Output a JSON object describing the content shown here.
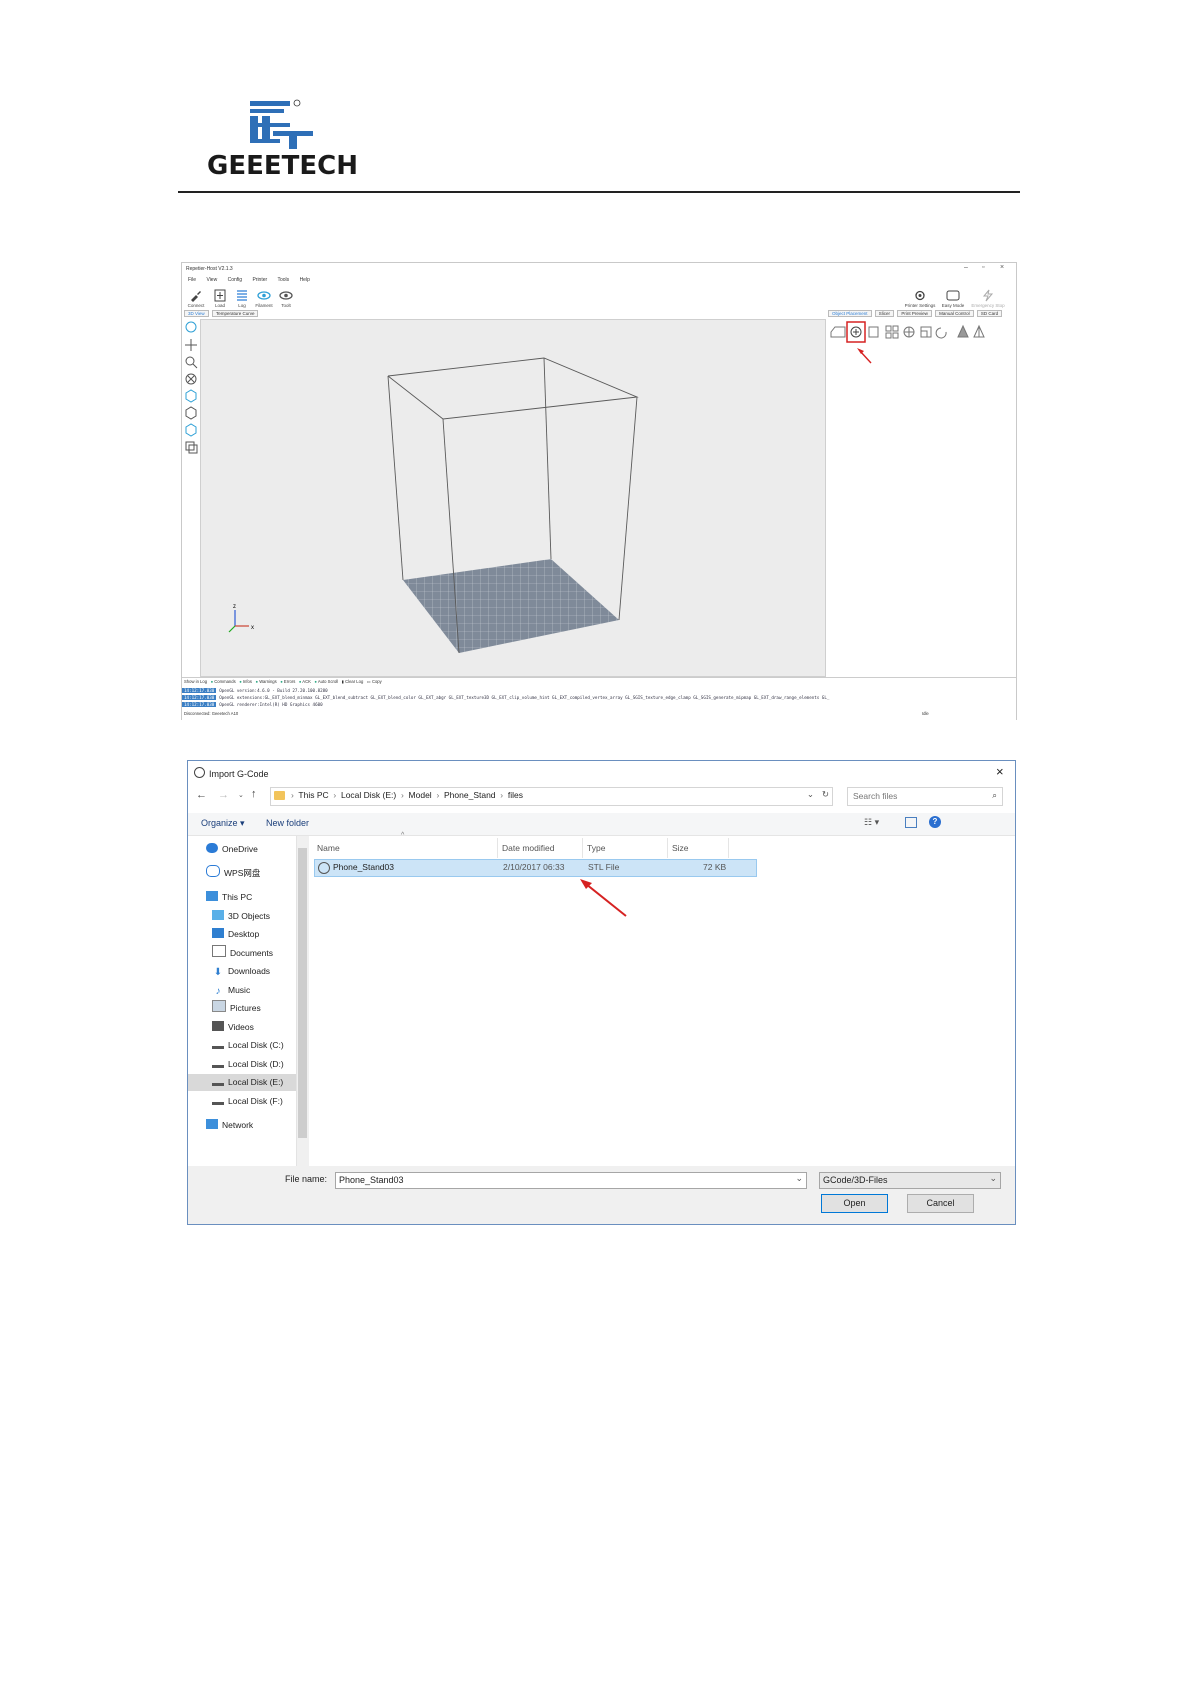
{
  "header": {
    "logo_text": "GEEETECH"
  },
  "repetier": {
    "title": "Repetier-Host V2.1.3",
    "menu": [
      "File",
      "View",
      "Config",
      "Printer",
      "Tools",
      "Help"
    ],
    "toolbar": [
      "Connect",
      "Load",
      "Log",
      "Filament",
      "Toolt"
    ],
    "right_toolbar": [
      "Printer Settings",
      "Easy Mode",
      "Emergency Stop"
    ],
    "left_tabs": [
      "3D View",
      "Temperature Curve"
    ],
    "right_tabs": [
      "Object Placement",
      "Slicer",
      "Print Preview",
      "Manual Control",
      "SD Card"
    ],
    "log_toolbar": [
      "Show in Log",
      "Commands",
      "Infos",
      "Warnings",
      "Errors",
      "ACK",
      "Auto Scroll",
      "Clear Log",
      "Copy"
    ],
    "log_lines": [
      {
        "time": "14:12:17.030",
        "msg": "OpenGL version:4.6.0 - Build 27.20.100.8280"
      },
      {
        "time": "14:12:17.030",
        "msg": "OpenGL extensions:GL_EXT_blend_minmax GL_EXT_blend_subtract GL_EXT_blend_color GL_EXT_abgr GL_EXT_texture3D GL_EXT_clip_volume_hint GL_EXT_compiled_vertex_array GL_SGIS_texture_edge_clamp GL_SGIS_generate_mipmap GL_EXT_draw_range_elements GL_"
      },
      {
        "time": "14:12:17.030",
        "msg": "OpenGL renderer:Intel(R) HD Graphics 4600"
      }
    ],
    "status_left": "Disconnected: Geeetech A10",
    "status_right": "Idle"
  },
  "dialog": {
    "title": "Import G-Code",
    "breadcrumb": [
      "This PC",
      "Local Disk (E:)",
      "Model",
      "Phone_Stand",
      "files"
    ],
    "search_placeholder": "Search files",
    "organize": "Organize ▾",
    "new_folder": "New folder",
    "nav": [
      {
        "label": "OneDrive",
        "icon": "cloud-icon",
        "indent": 1
      },
      {
        "label": "WPS网盘",
        "icon": "cloud-drive-icon",
        "indent": 1
      },
      {
        "label": "This PC",
        "icon": "computer-icon",
        "indent": 1
      },
      {
        "label": "3D Objects",
        "icon": "cube-icon",
        "indent": 2
      },
      {
        "label": "Desktop",
        "icon": "desktop-icon",
        "indent": 2
      },
      {
        "label": "Documents",
        "icon": "documents-icon",
        "indent": 2
      },
      {
        "label": "Downloads",
        "icon": "downloads-icon",
        "indent": 2
      },
      {
        "label": "Music",
        "icon": "music-icon",
        "indent": 2
      },
      {
        "label": "Pictures",
        "icon": "pictures-icon",
        "indent": 2
      },
      {
        "label": "Videos",
        "icon": "videos-icon",
        "indent": 2
      },
      {
        "label": "Local Disk (C:)",
        "icon": "drive-icon",
        "indent": 2
      },
      {
        "label": "Local Disk (D:)",
        "icon": "drive-icon",
        "indent": 2
      },
      {
        "label": "Local Disk (E:)",
        "icon": "drive-icon",
        "indent": 2
      },
      {
        "label": "Local Disk (F:)",
        "icon": "drive-icon",
        "indent": 2
      },
      {
        "label": "Network",
        "icon": "network-icon",
        "indent": 1
      }
    ],
    "columns": [
      "Name",
      "Date modified",
      "Type",
      "Size"
    ],
    "file": {
      "name": "Phone_Stand03",
      "date": "2/10/2017 06:33",
      "type": "STL File",
      "size": "72 KB"
    },
    "filename_label": "File name:",
    "filename_value": "Phone_Stand03",
    "filter": "GCode/3D-Files",
    "open": "Open",
    "cancel": "Cancel"
  }
}
